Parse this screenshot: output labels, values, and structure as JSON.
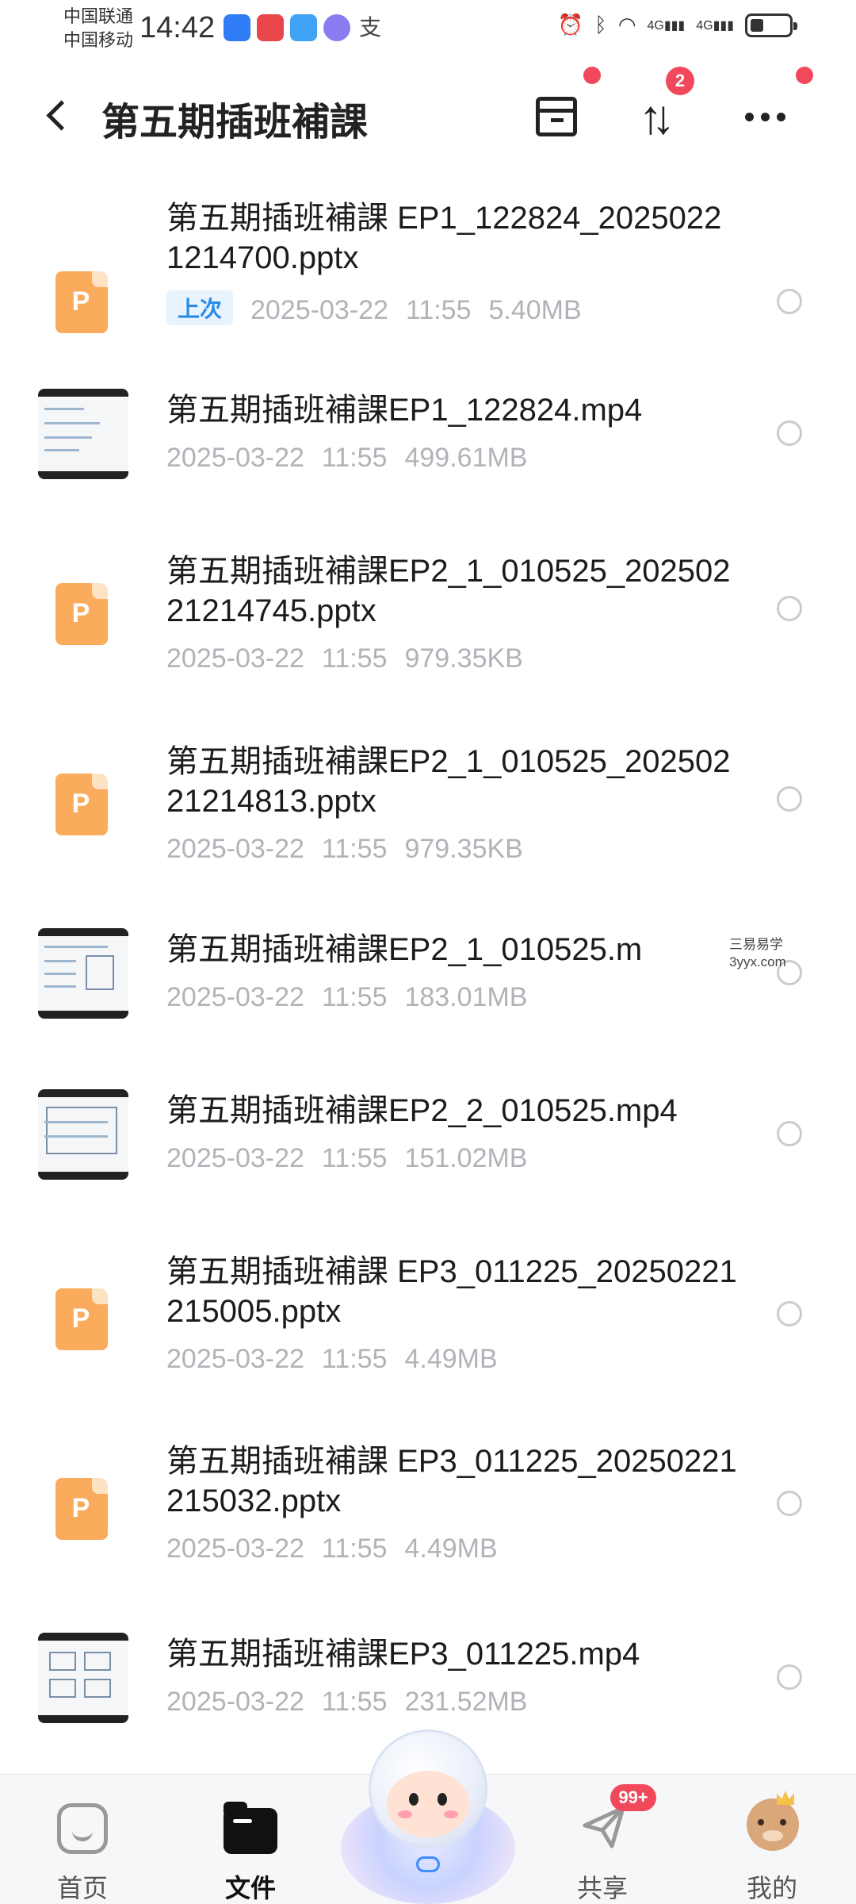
{
  "status_bar": {
    "carrier_1": "中国联通",
    "carrier_2": "中国移动",
    "time": "14:42",
    "signal_1": "4G",
    "signal_2": "4G"
  },
  "header": {
    "title": "第五期插班補課",
    "sort_badge": "2"
  },
  "files": [
    {
      "name": "第五期插班補課 EP1_122824_20250221214700.pptx",
      "badge": "上次",
      "date": "2025-03-22",
      "time": "11:55",
      "size": "5.40MB",
      "kind": "pptx"
    },
    {
      "name": "第五期插班補課EP1_122824.mp4",
      "date": "2025-03-22",
      "time": "11:55",
      "size": "499.61MB",
      "kind": "mp4"
    },
    {
      "name": "第五期插班補課EP2_1_010525_20250221214745.pptx",
      "date": "2025-03-22",
      "time": "11:55",
      "size": "979.35KB",
      "kind": "pptx"
    },
    {
      "name": "第五期插班補課EP2_1_010525_20250221214813.pptx",
      "date": "2025-03-22",
      "time": "11:55",
      "size": "979.35KB",
      "kind": "pptx"
    },
    {
      "name": "第五期插班補課EP2_1_010525.m",
      "date": "2025-03-22",
      "time": "11:55",
      "size": "183.01MB",
      "kind": "mp4"
    },
    {
      "name": "第五期插班補課EP2_2_010525.mp4",
      "date": "2025-03-22",
      "time": "11:55",
      "size": "151.02MB",
      "kind": "mp4"
    },
    {
      "name": "第五期插班補課 EP3_011225_20250221215005.pptx",
      "date": "2025-03-22",
      "time": "11:55",
      "size": "4.49MB",
      "kind": "pptx"
    },
    {
      "name": "第五期插班補課 EP3_011225_20250221215032.pptx",
      "date": "2025-03-22",
      "time": "11:55",
      "size": "4.49MB",
      "kind": "pptx"
    },
    {
      "name": "第五期插班補課EP3_011225.mp4",
      "date": "2025-03-22",
      "time": "11:55",
      "size": "231.52MB",
      "kind": "mp4"
    }
  ],
  "watermark": {
    "line1": "三易易学",
    "line2": "3yyx.com"
  },
  "bottom_nav": {
    "home": "首页",
    "files": "文件",
    "share": "共享",
    "share_badge": "99+",
    "mine": "我的"
  }
}
